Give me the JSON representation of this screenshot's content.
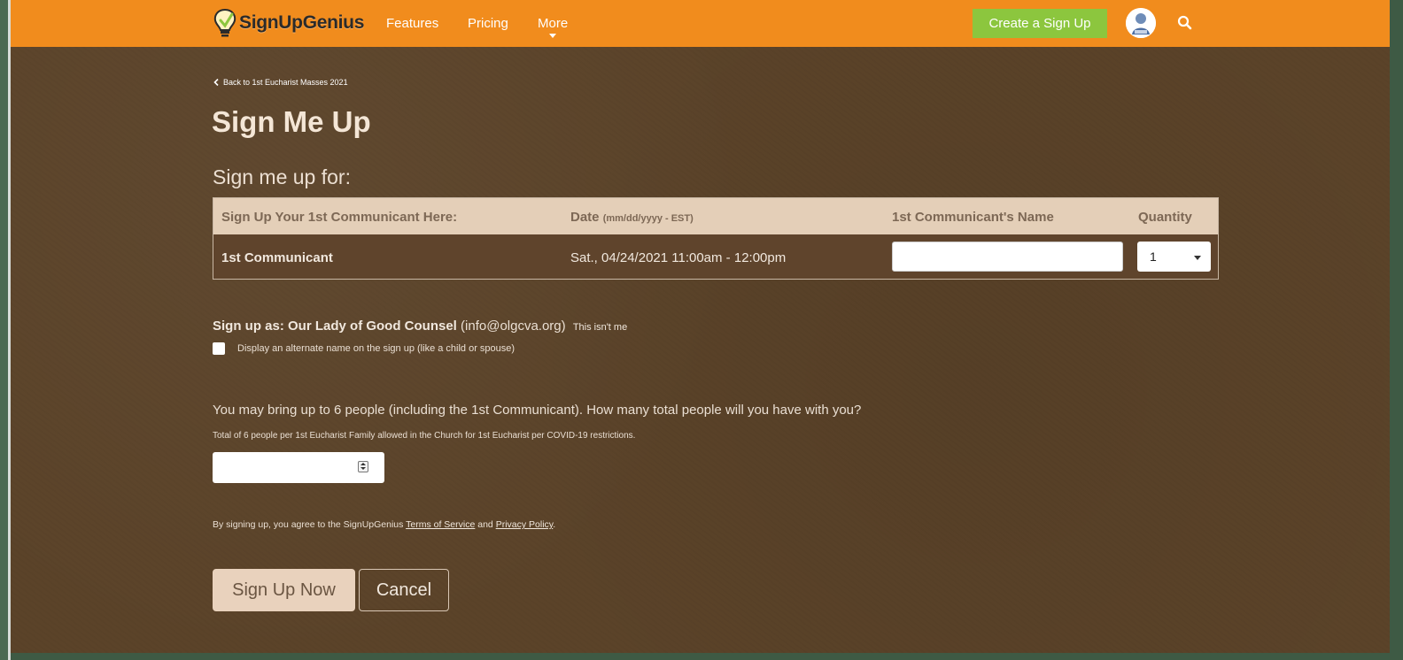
{
  "header": {
    "logo_text": "SignUpGenius",
    "nav": [
      "Features",
      "Pricing",
      "More"
    ],
    "create_button": "Create a Sign Up"
  },
  "back_link": "Back to 1st Eucharist Masses 2021",
  "title": "Sign Me Up",
  "subtitle": "Sign me up for:",
  "table": {
    "headers": {
      "slot": "Sign Up Your 1st Communicant Here:",
      "date": "Date",
      "date_hint": "(mm/dd/yyyy - EST)",
      "name": "1st Communicant's Name",
      "quantity": "Quantity"
    },
    "row": {
      "slot": "1st Communicant",
      "date": "Sat., 04/24/2021 11:00am - 12:00pm",
      "name_value": "",
      "quantity": "1"
    }
  },
  "sign_up_as": {
    "prefix": "Sign up as:",
    "name": "Our Lady of Good Counsel",
    "email": "(info@olgcva.org)",
    "not_me": "This isn't me"
  },
  "alternate_name_checkbox": {
    "label": "Display an alternate name on the sign up (like a child or spouse)",
    "checked": false
  },
  "question": {
    "text": "You may bring up to 6 people (including the 1st Communicant). How many total people will you have with you?",
    "note": "Total of 6 people per 1st Eucharist Family allowed in the Church for 1st Eucharist per COVID-19 restrictions.",
    "value": ""
  },
  "agreement": {
    "prefix": "By signing up, you agree to the SignUpGenius",
    "terms": "Terms of Service",
    "and": "and",
    "privacy": "Privacy Policy",
    "suffix": "."
  },
  "buttons": {
    "submit": "Sign Up Now",
    "cancel": "Cancel"
  },
  "colors": {
    "topbar": "#f18c1d",
    "create_button": "#8cc63e",
    "page_background": "#5b4329",
    "table_header": "#e4cfb8",
    "table_row": "#5f442c",
    "submit_button": "#e9d2bd"
  }
}
